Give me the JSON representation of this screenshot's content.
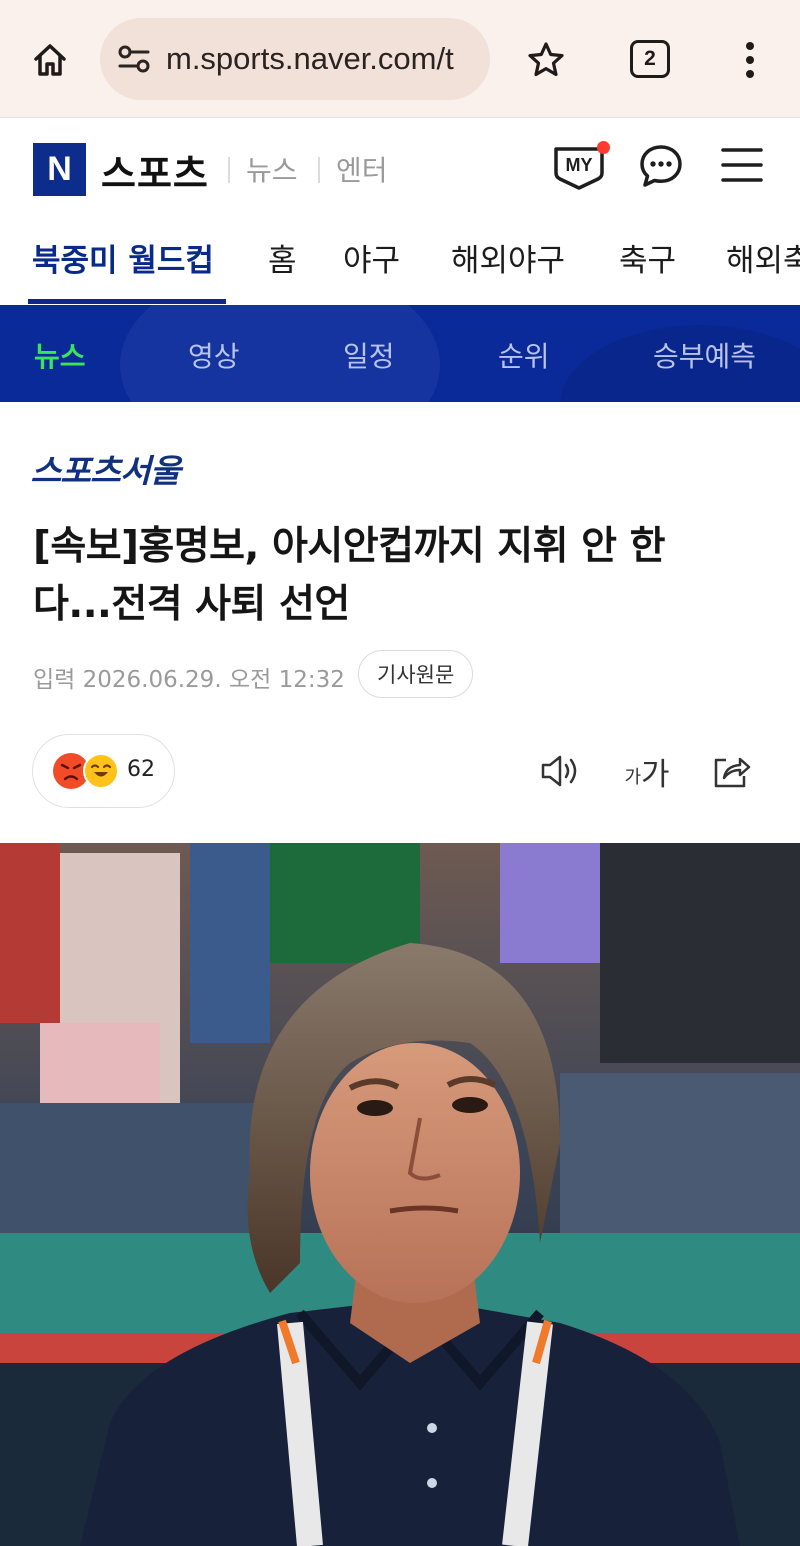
{
  "browser": {
    "url": "m.sports.naver.com/t",
    "tab_count": "2",
    "icons": [
      "home-icon",
      "site-settings-icon",
      "star-icon",
      "tabs-icon",
      "more-vert-icon"
    ]
  },
  "header": {
    "logo_letter": "N",
    "section_title": "스포츠",
    "links": [
      "뉴스",
      "엔터"
    ],
    "my_label": "MY"
  },
  "main_nav": {
    "items": [
      "북중미 월드컵",
      "홈",
      "야구",
      "해외야구",
      "축구",
      "해외축"
    ],
    "active": "북중미 월드컵"
  },
  "sub_nav": {
    "items": [
      "뉴스",
      "영상",
      "일정",
      "순위",
      "승부예측"
    ],
    "active": "뉴스",
    "colors": {
      "background": "#0a2a9a",
      "active": "#39e35a"
    }
  },
  "article": {
    "press": "스포츠서울",
    "title_line1": "[속보]홍명보, 아시안컵까지 지휘 안 한",
    "title_line2": "다...전격 사퇴 선언",
    "date": "입력 2026.06.29. 오전 12:32",
    "original_button": "기사원문",
    "reaction_count": "62",
    "font_size_label_small": "가",
    "font_size_label_large": "가"
  }
}
